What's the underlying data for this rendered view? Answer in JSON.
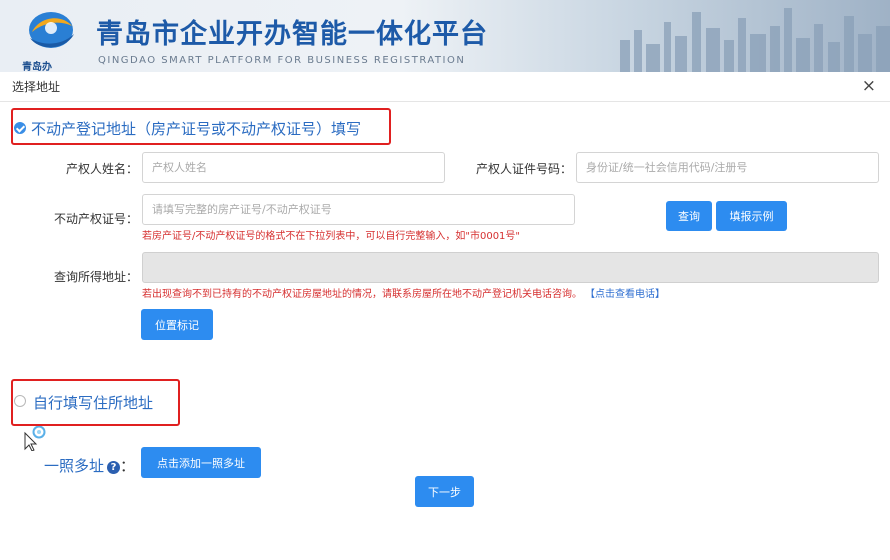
{
  "banner": {
    "title": "青岛市企业开办智能一体化平台",
    "subtitle": "QINGDAO SMART PLATFORM FOR BUSINESS REGISTRATION",
    "logo_text": "青岛办"
  },
  "dialog": {
    "title": "选择地址",
    "close": "×"
  },
  "option1": {
    "label": "不动产登记地址（房产证号或不动产权证号）填写",
    "owner_name_label": "产权人姓名：",
    "owner_name_placeholder": "产权人姓名",
    "owner_id_label": "产权人证件号码：",
    "owner_id_placeholder": "身份证/统一社会信用代码/注册号",
    "cert_label": "不动产权证号：",
    "cert_placeholder": "请填写完整的房产证号/不动产权证号",
    "cert_hint": "若房产证号/不动产权证号的格式不在下拉列表中，可以自行完整输入，如\"市0001号\"",
    "query_button": "查询",
    "example_button": "填报示例",
    "result_label": "查询所得地址：",
    "result_hint": "若出现查询不到已持有的不动产权证房屋地址的情况，请联系房屋所在地不动产登记机关电话咨询。",
    "result_hint_link": "【点击查看电话】",
    "locate_button": "位置标记"
  },
  "option2": {
    "label": "自行填写住所地址"
  },
  "multi_address": {
    "label": "一照多址",
    "colon": "：",
    "help_icon": "?",
    "add_button": "点击添加一照多址"
  },
  "next_button": "下一步",
  "colors": {
    "accent": "#2d8cf0",
    "highlight_border": "#e02020",
    "hint_text": "#d63030",
    "option_text": "#2b6cc2"
  }
}
